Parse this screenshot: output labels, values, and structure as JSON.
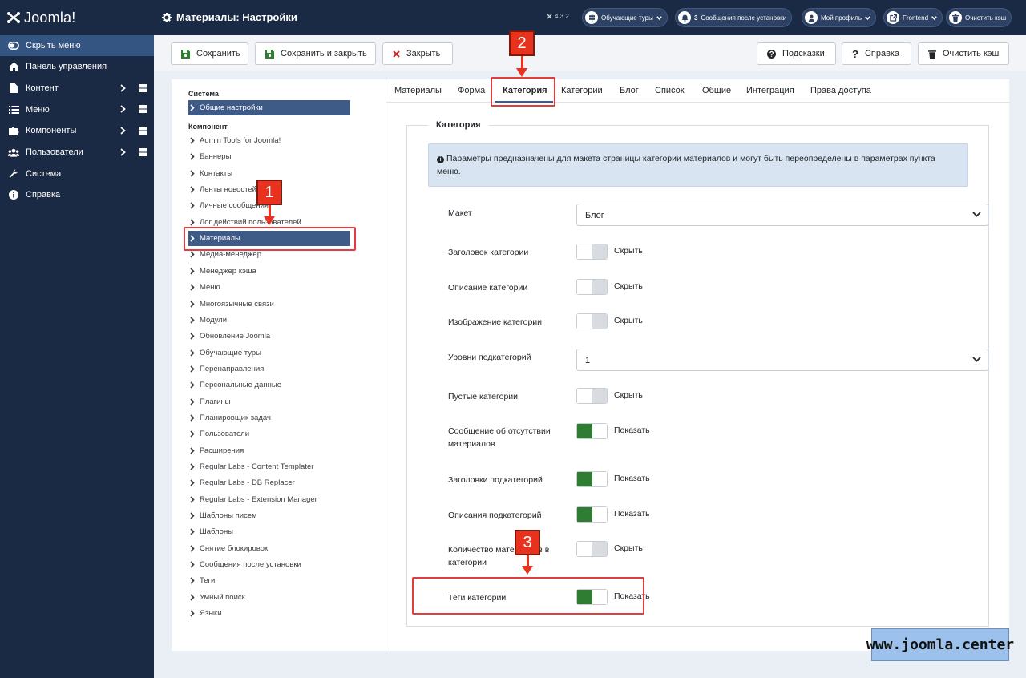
{
  "sidebar": {
    "logo_text": "Joomla!",
    "items": [
      {
        "label": "Скрыть меню",
        "icon": "toggle-icon"
      },
      {
        "label": "Панель управления",
        "icon": "home-icon"
      },
      {
        "label": "Контент",
        "icon": "file-icon"
      },
      {
        "label": "Меню",
        "icon": "list-icon"
      },
      {
        "label": "Компоненты",
        "icon": "puzzle-icon"
      },
      {
        "label": "Пользователи",
        "icon": "users-icon"
      },
      {
        "label": "Система",
        "icon": "wrench-icon"
      },
      {
        "label": "Справка",
        "icon": "info-icon"
      }
    ]
  },
  "header": {
    "title": "Материалы: Настройки",
    "version": "4.3.2",
    "buttons": {
      "tours": "Обучающие туры",
      "messages_count": "3",
      "messages": "Сообщения после установки",
      "profile": "Мой профиль",
      "frontend": "Frontend",
      "clear_cache": "Очистить кэш"
    }
  },
  "toolbar": {
    "save": "Сохранить",
    "save_close": "Сохранить и закрыть",
    "close": "Закрыть",
    "hints": "Подсказки",
    "help": "Справка",
    "clear_cache": "Очистить кэш"
  },
  "left": {
    "system_title": "Система",
    "global_settings": "Общие настройки",
    "component_title": "Компонент",
    "components": [
      "Admin Tools for Joomla!",
      "Баннеры",
      "Контакты",
      "Ленты новостей",
      "Личные сообщения",
      "Лог действий пользователей",
      "Материалы",
      "Медиа-менеджер",
      "Менеджер кэша",
      "Меню",
      "Многоязычные связи",
      "Модули",
      "Обновление Joomla",
      "Обучающие туры",
      "Перенаправления",
      "Персональные данные",
      "Плагины",
      "Планировщик задач",
      "Пользователи",
      "Расширения",
      "Regular Labs - Content Templater",
      "Regular Labs - DB Replacer",
      "Regular Labs - Extension Manager",
      "Шаблоны писем",
      "Шаблоны",
      "Снятие блокировок",
      "Сообщения после установки",
      "Теги",
      "Умный поиск",
      "Языки"
    ]
  },
  "tabs": [
    "Материалы",
    "Форма",
    "Категория",
    "Категории",
    "Блог",
    "Список",
    "Общие",
    "Интеграция",
    "Права доступа"
  ],
  "fieldset": {
    "legend": "Категория",
    "info": "Параметры предназначены для макета страницы категории материалов и могут быть переопределены в параметрах пункта меню.",
    "fields": [
      {
        "label": "Макет",
        "type": "select",
        "value": "Блог"
      },
      {
        "label": "Заголовок категории",
        "type": "toggle",
        "on": false,
        "state_label": "Скрыть"
      },
      {
        "label": "Описание категории",
        "type": "toggle",
        "on": false,
        "state_label": "Скрыть"
      },
      {
        "label": "Изображение категории",
        "type": "toggle",
        "on": false,
        "state_label": "Скрыть"
      },
      {
        "label": "Уровни подкатегорий",
        "type": "select",
        "value": "1"
      },
      {
        "label": "Пустые категории",
        "type": "toggle",
        "on": false,
        "state_label": "Скрыть"
      },
      {
        "label": "Сообщение об отсутствии материалов",
        "type": "toggle",
        "on": true,
        "state_label": "Показать"
      },
      {
        "label": "Заголовки подкатегорий",
        "type": "toggle",
        "on": true,
        "state_label": "Показать"
      },
      {
        "label": "Описания подкатегорий",
        "type": "toggle",
        "on": true,
        "state_label": "Показать"
      },
      {
        "label": "Количество материалов в категории",
        "type": "toggle",
        "on": false,
        "state_label": "Скрыть"
      },
      {
        "label": "Теги категории",
        "type": "toggle",
        "on": true,
        "state_label": "Показать"
      }
    ]
  },
  "annotations": {
    "marker1": "1",
    "marker2": "2",
    "marker3": "3"
  },
  "watermark": "www.joomla.center",
  "colors": {
    "sidebar": "#1b2a44",
    "accent": "#3e5a86",
    "toggle_on": "#2e7d32",
    "annotation": "#e8321e"
  }
}
